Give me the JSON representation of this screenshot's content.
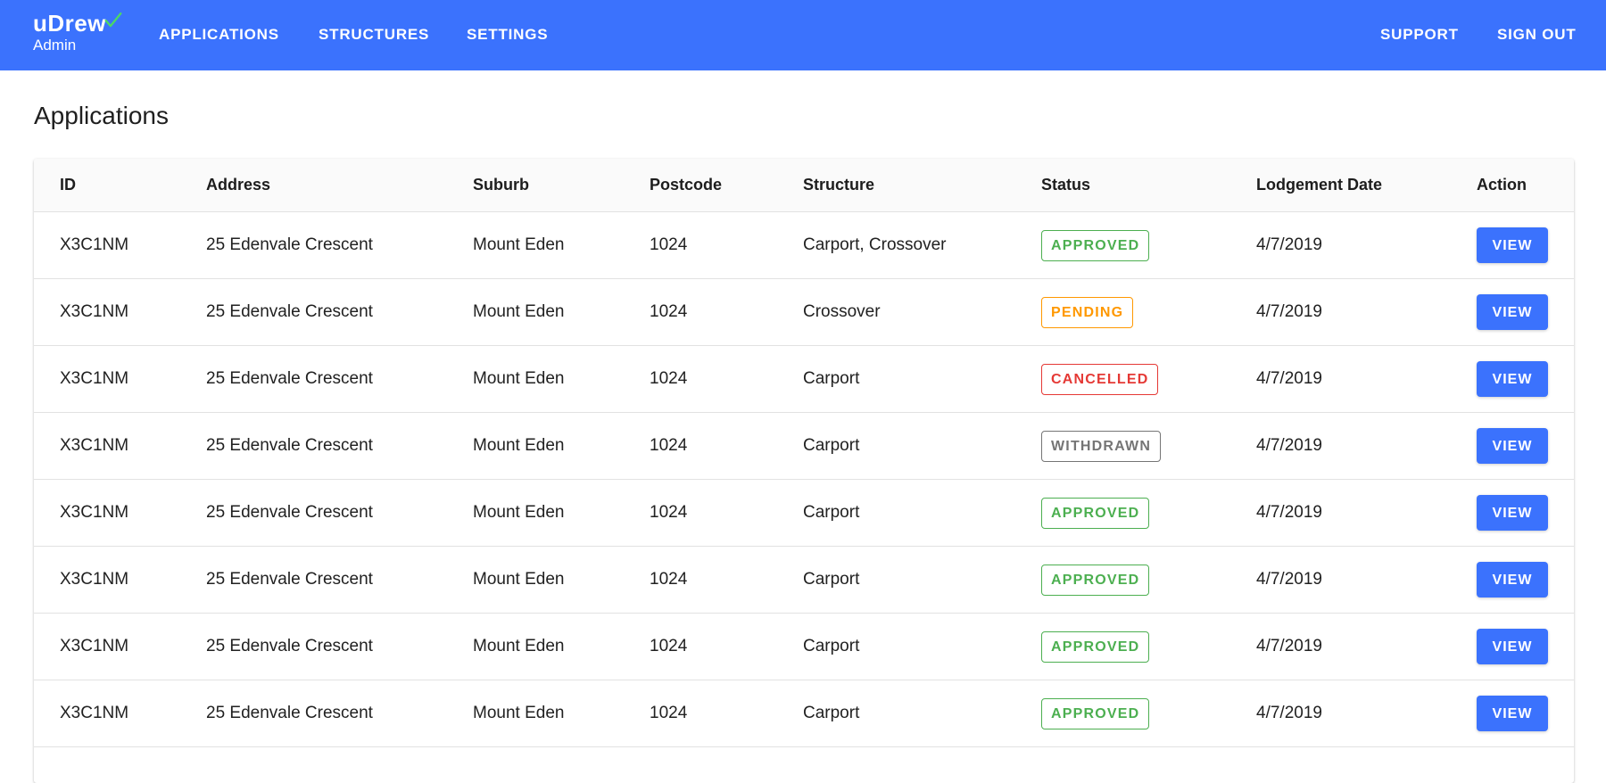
{
  "brand": {
    "name": "uDrew",
    "subtitle": "Admin",
    "check_color": "#4cd964"
  },
  "nav": {
    "left": [
      {
        "label": "APPLICATIONS"
      },
      {
        "label": "STRUCTURES"
      },
      {
        "label": "SETTINGS"
      }
    ],
    "right": [
      {
        "label": "SUPPORT"
      },
      {
        "label": "SIGN OUT"
      }
    ]
  },
  "page": {
    "title": "Applications"
  },
  "colors": {
    "primary": "#3b72fd",
    "approved": "#4caf50",
    "pending": "#ff9800",
    "cancelled": "#e53935",
    "withdrawn": "#757575"
  },
  "table": {
    "columns": [
      "ID",
      "Address",
      "Suburb",
      "Postcode",
      "Structure",
      "Status",
      "Lodgement Date",
      "Action"
    ],
    "rows": [
      {
        "id": "X3C1NM",
        "address": "25 Edenvale Crescent",
        "suburb": "Mount Eden",
        "postcode": "1024",
        "structure": "Carport, Crossover",
        "status": "APPROVED",
        "status_kind": "approved",
        "date": "4/7/2019",
        "action": "VIEW"
      },
      {
        "id": "X3C1NM",
        "address": "25 Edenvale Crescent",
        "suburb": "Mount Eden",
        "postcode": "1024",
        "structure": "Crossover",
        "status": "PENDING",
        "status_kind": "pending",
        "date": "4/7/2019",
        "action": "VIEW"
      },
      {
        "id": "X3C1NM",
        "address": "25 Edenvale Crescent",
        "suburb": "Mount Eden",
        "postcode": "1024",
        "structure": "Carport",
        "status": "CANCELLED",
        "status_kind": "cancelled",
        "date": "4/7/2019",
        "action": "VIEW"
      },
      {
        "id": "X3C1NM",
        "address": "25 Edenvale Crescent",
        "suburb": "Mount Eden",
        "postcode": "1024",
        "structure": "Carport",
        "status": "WITHDRAWN",
        "status_kind": "withdrawn",
        "date": "4/7/2019",
        "action": "VIEW"
      },
      {
        "id": "X3C1NM",
        "address": "25 Edenvale Crescent",
        "suburb": "Mount Eden",
        "postcode": "1024",
        "structure": "Carport",
        "status": "APPROVED",
        "status_kind": "approved",
        "date": "4/7/2019",
        "action": "VIEW"
      },
      {
        "id": "X3C1NM",
        "address": "25 Edenvale Crescent",
        "suburb": "Mount Eden",
        "postcode": "1024",
        "structure": "Carport",
        "status": "APPROVED",
        "status_kind": "approved",
        "date": "4/7/2019",
        "action": "VIEW"
      },
      {
        "id": "X3C1NM",
        "address": "25 Edenvale Crescent",
        "suburb": "Mount Eden",
        "postcode": "1024",
        "structure": "Carport",
        "status": "APPROVED",
        "status_kind": "approved",
        "date": "4/7/2019",
        "action": "VIEW"
      },
      {
        "id": "X3C1NM",
        "address": "25 Edenvale Crescent",
        "suburb": "Mount Eden",
        "postcode": "1024",
        "structure": "Carport",
        "status": "APPROVED",
        "status_kind": "approved",
        "date": "4/7/2019",
        "action": "VIEW"
      }
    ]
  }
}
